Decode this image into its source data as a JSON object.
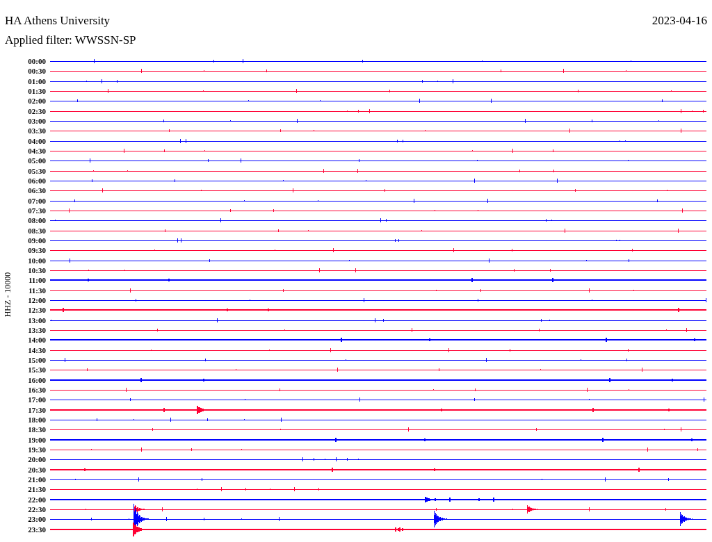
{
  "header": {
    "station": "HA Athens University",
    "date": "2023-04-16",
    "filter": "Applied filter: WWSSN-SP"
  },
  "axis_label": "HHZ - 10000",
  "traces": [
    {
      "time": "00:00",
      "color": "#0000ff"
    },
    {
      "time": "00:30",
      "color": "#ff0033"
    },
    {
      "time": "01:00",
      "color": "#0000ff"
    },
    {
      "time": "01:30",
      "color": "#ff0033"
    },
    {
      "time": "02:00",
      "color": "#0000ff"
    },
    {
      "time": "02:30",
      "color": "#ff0033"
    },
    {
      "time": "03:00",
      "color": "#0000ff"
    },
    {
      "time": "03:30",
      "color": "#ff0033"
    },
    {
      "time": "04:00",
      "color": "#0000ff"
    },
    {
      "time": "04:30",
      "color": "#ff0033"
    },
    {
      "time": "05:00",
      "color": "#0000ff"
    },
    {
      "time": "05:30",
      "color": "#ff0033"
    },
    {
      "time": "06:00",
      "color": "#0000ff"
    },
    {
      "time": "06:30",
      "color": "#ff0033"
    },
    {
      "time": "07:00",
      "color": "#0000ff"
    },
    {
      "time": "07:30",
      "color": "#ff0033"
    },
    {
      "time": "08:00",
      "color": "#0000ff"
    },
    {
      "time": "08:30",
      "color": "#ff0033"
    },
    {
      "time": "09:00",
      "color": "#0000ff"
    },
    {
      "time": "09:30",
      "color": "#ff0033"
    },
    {
      "time": "10:00",
      "color": "#0000ff"
    },
    {
      "time": "10:30",
      "color": "#ff0033"
    },
    {
      "time": "11:00",
      "color": "#0000ff"
    },
    {
      "time": "11:30",
      "color": "#ff0033"
    },
    {
      "time": "12:00",
      "color": "#0000ff"
    },
    {
      "time": "12:30",
      "color": "#ff0033"
    },
    {
      "time": "13:00",
      "color": "#0000ff"
    },
    {
      "time": "13:30",
      "color": "#ff0033"
    },
    {
      "time": "14:00",
      "color": "#0000ff"
    },
    {
      "time": "14:30",
      "color": "#ff0033"
    },
    {
      "time": "15:00",
      "color": "#0000ff"
    },
    {
      "time": "15:30",
      "color": "#ff0033"
    },
    {
      "time": "16:00",
      "color": "#0000ff"
    },
    {
      "time": "16:30",
      "color": "#ff0033"
    },
    {
      "time": "17:00",
      "color": "#0000ff"
    },
    {
      "time": "17:30",
      "color": "#ff0033"
    },
    {
      "time": "18:00",
      "color": "#0000ff"
    },
    {
      "time": "18:30",
      "color": "#ff0033"
    },
    {
      "time": "19:00",
      "color": "#0000ff"
    },
    {
      "time": "19:30",
      "color": "#ff0033"
    },
    {
      "time": "20:00",
      "color": "#0000ff"
    },
    {
      "time": "20:30",
      "color": "#ff0033"
    },
    {
      "time": "21:00",
      "color": "#0000ff"
    },
    {
      "time": "21:30",
      "color": "#ff0033"
    },
    {
      "time": "22:00",
      "color": "#0000ff"
    },
    {
      "time": "22:30",
      "color": "#ff0033"
    },
    {
      "time": "23:00",
      "color": "#0000ff"
    },
    {
      "time": "23:30",
      "color": "#ff0033"
    }
  ]
}
